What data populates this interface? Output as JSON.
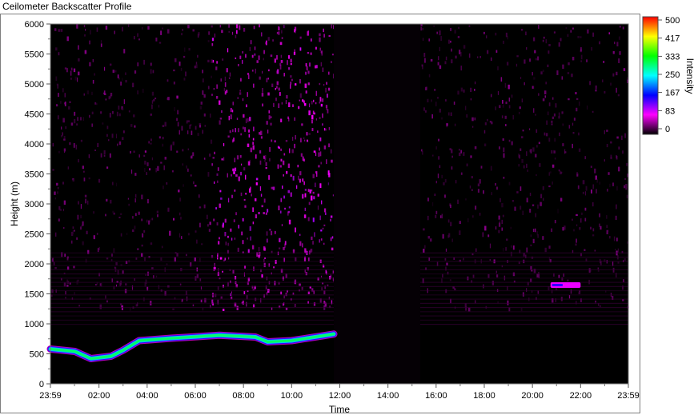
{
  "window": {
    "title": "Ceilometer Backscatter Profile"
  },
  "chart_data": {
    "type": "heatmap",
    "title": "Ceilometer Backscatter Profile",
    "xlabel": "Time",
    "ylabel": "Height (m)",
    "colorbar_label": "Intensity",
    "x_ticks": [
      "23:59",
      "02:00",
      "04:00",
      "06:00",
      "08:00",
      "10:00",
      "12:00",
      "14:00",
      "16:00",
      "18:00",
      "20:00",
      "22:00",
      "23:59"
    ],
    "y_ticks": [
      0,
      500,
      1000,
      1500,
      2000,
      2500,
      3000,
      3500,
      4000,
      4500,
      5000,
      5500,
      6000
    ],
    "ylim": [
      0,
      6000
    ],
    "colorbar_ticks": [
      0,
      83,
      167,
      250,
      333,
      417,
      500
    ],
    "colorbar_range": [
      0,
      500
    ],
    "colormap": [
      "#000000",
      "#ff00ff",
      "#0000ff",
      "#00ffff",
      "#00ff00",
      "#ffff00",
      "#ff0000"
    ],
    "no_data_gap": [
      "11:45",
      "15:20"
    ],
    "cloud_base_layer": [
      {
        "time": "23:59",
        "height": 580
      },
      {
        "time": "01:00",
        "height": 540
      },
      {
        "time": "01:40",
        "height": 420
      },
      {
        "time": "02:30",
        "height": 460
      },
      {
        "time": "03:00",
        "height": 560
      },
      {
        "time": "03:40",
        "height": 720
      },
      {
        "time": "05:00",
        "height": 760
      },
      {
        "time": "07:00",
        "height": 810
      },
      {
        "time": "08:30",
        "height": 780
      },
      {
        "time": "09:00",
        "height": 700
      },
      {
        "time": "10:00",
        "height": 720
      },
      {
        "time": "11:45",
        "height": 830
      }
    ],
    "elevated_layer": {
      "start": "20:45",
      "end": "22:00",
      "height": 1640
    },
    "noise_band_top_heights": [
      6000,
      2200,
      6000
    ],
    "noise_enhanced_window": [
      "06:40",
      "11:45"
    ]
  }
}
